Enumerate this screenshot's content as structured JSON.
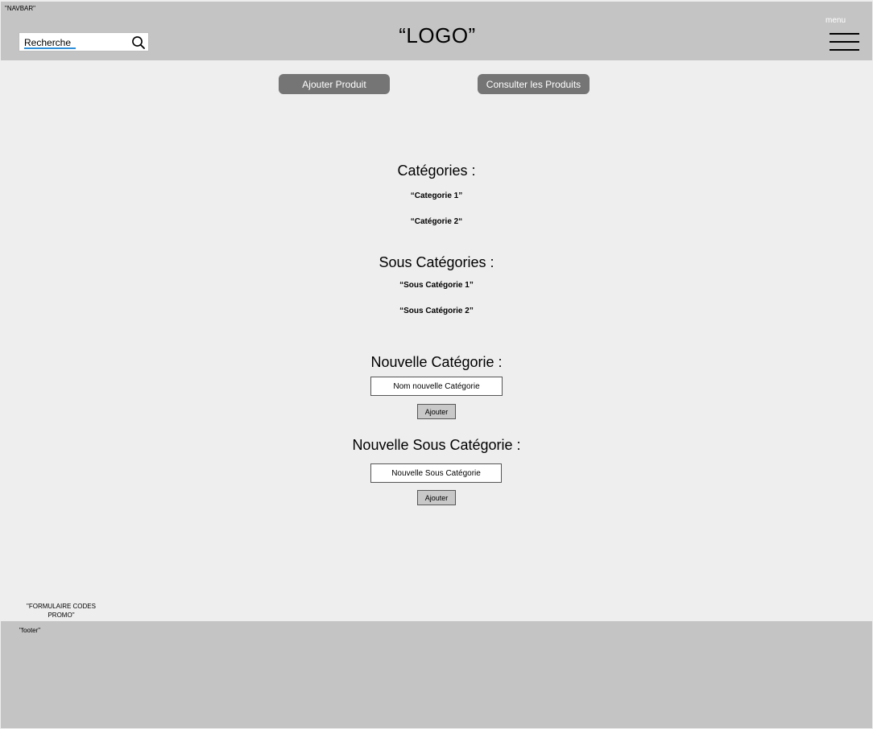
{
  "navbar": {
    "tag": "\"NAVBAR\"",
    "search_value": "Recherche",
    "logo": "“LOGO”",
    "menu_label": "menu"
  },
  "actions": {
    "add_product": "Ajouter Produit",
    "view_products": "Consulter les Produits"
  },
  "categories": {
    "title": "Catégories :",
    "items": [
      "“Categorie 1”",
      "“Catégorie 2“"
    ]
  },
  "subcategories": {
    "title": "Sous Catégories :",
    "items": [
      "“Sous Catégorie 1”",
      "“Sous Catégorie 2”"
    ]
  },
  "new_category": {
    "title": "Nouvelle Catégorie :",
    "field_value": "Nom nouvelle Catégorie",
    "button": "Ajouter"
  },
  "new_subcategory": {
    "title": "Nouvelle Sous Catégorie :",
    "field_value": "Nouvelle Sous Catégorie",
    "button": "Ajouter"
  },
  "promo": {
    "label": "\"FORMULAIRE CODES PROMO\""
  },
  "footer": {
    "tag": "\"footer\""
  },
  "colors": {
    "navbar_bg": "#c4c4c4",
    "page_bg": "#eeeeee",
    "pill_button_bg": "#757575",
    "search_underline": "#2f8fd8"
  }
}
